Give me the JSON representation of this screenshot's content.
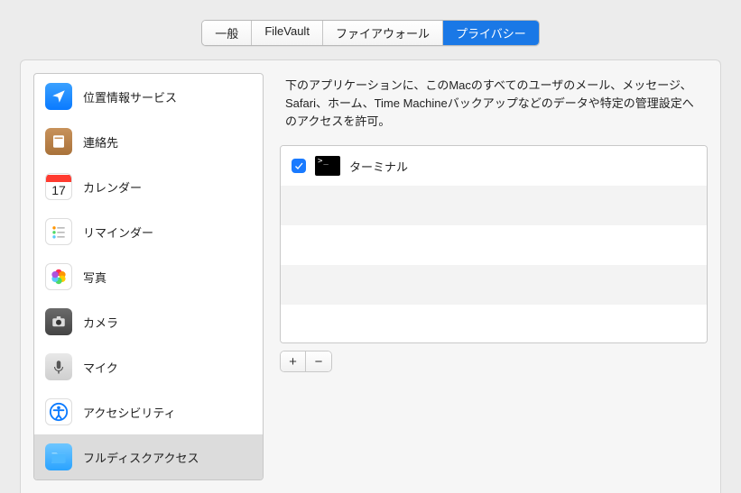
{
  "tabs": {
    "general": "一般",
    "filevault": "FileVault",
    "firewall": "ファイアウォール",
    "privacy": "プライバシー"
  },
  "sidebar": {
    "location": "位置情報サービス",
    "contacts": "連絡先",
    "calendar": "カレンダー",
    "calendar_day": "17",
    "reminders": "リマインダー",
    "photos": "写真",
    "camera": "カメラ",
    "microphone": "マイク",
    "accessibility": "アクセシビリティ",
    "full_disk": "フルディスクアクセス"
  },
  "detail": {
    "description": "下のアプリケーションに、このMacのすべてのユーザのメール、メッセージ、Safari、ホーム、Time Machineバックアップなどのデータや特定の管理設定へのアクセスを許可。",
    "apps": [
      {
        "name": "ターミナル",
        "checked": true
      }
    ],
    "add": "+",
    "remove": "−"
  }
}
